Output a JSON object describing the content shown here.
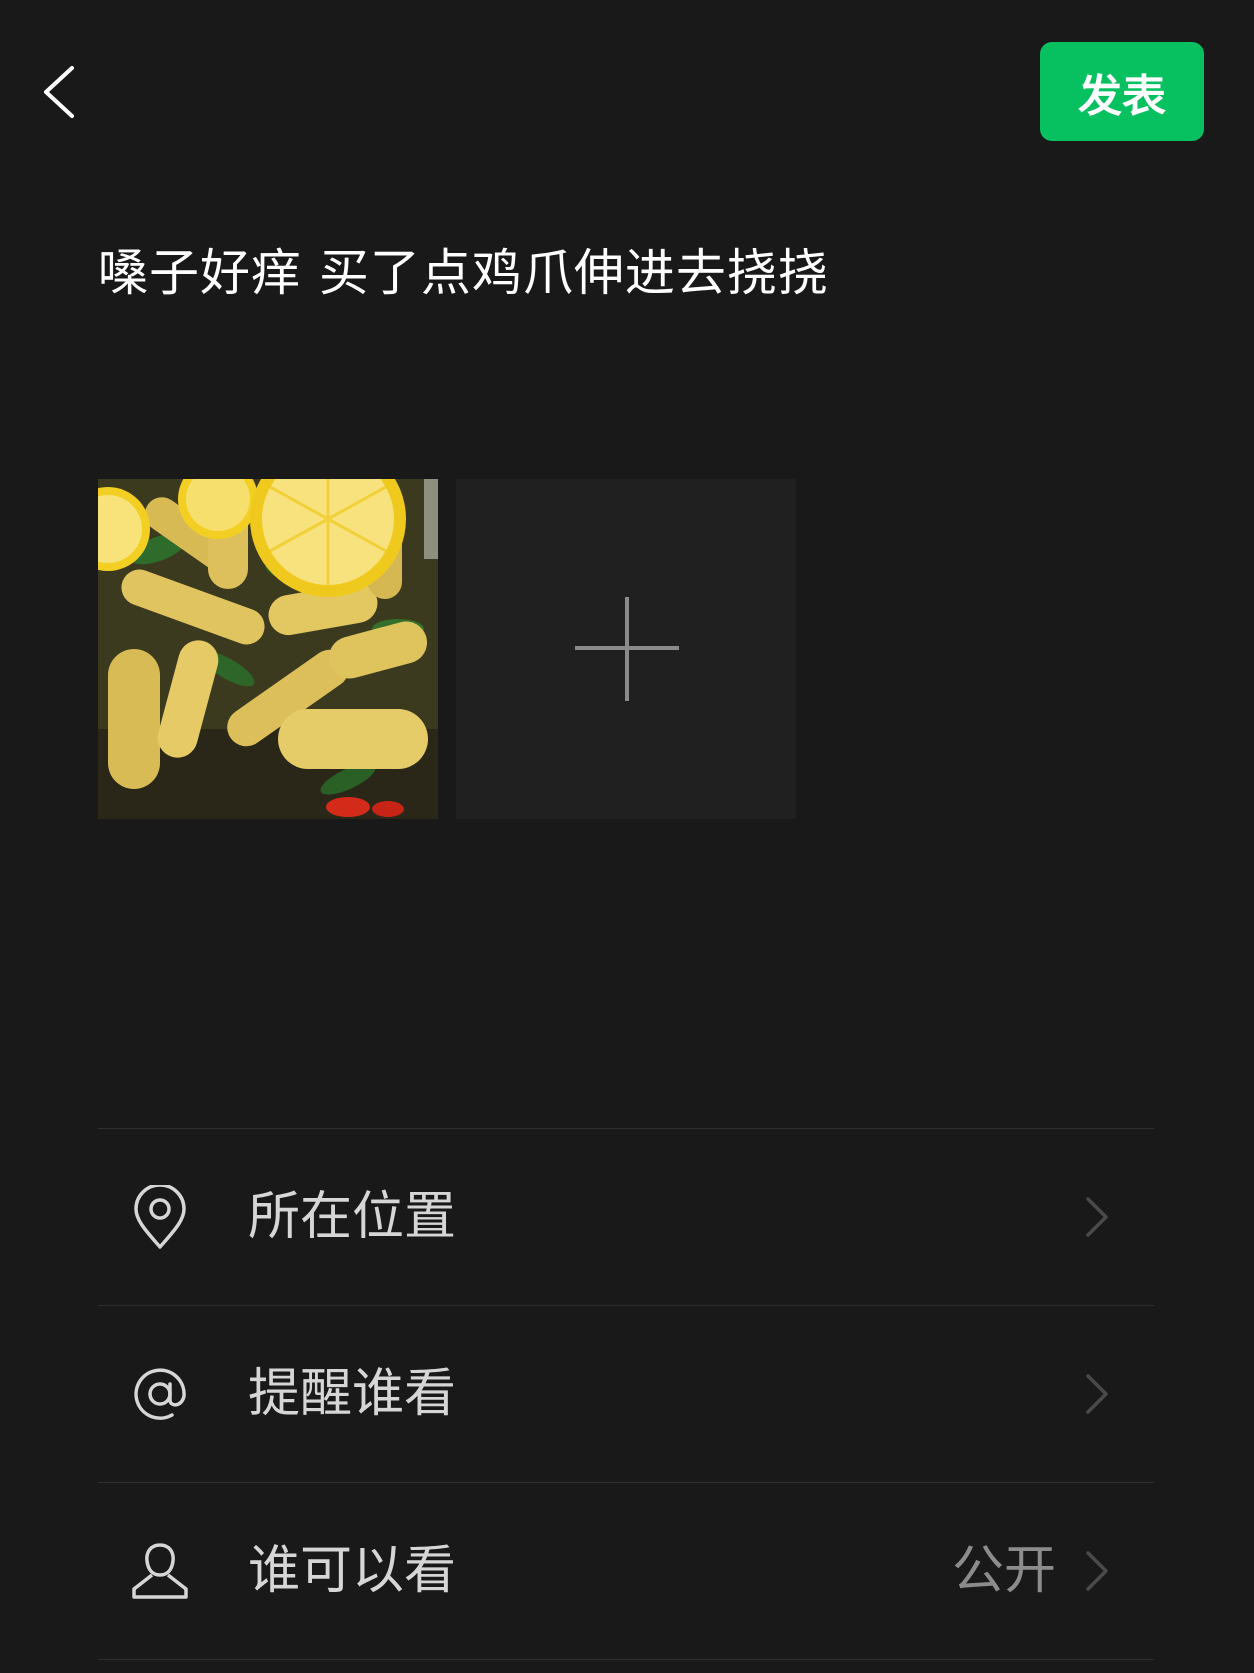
{
  "header": {
    "publish_label": "发表"
  },
  "post": {
    "text": "嗓子好痒 买了点鸡爪伸进去挠挠"
  },
  "media": {
    "photos": [
      {
        "subject": "chicken feet with lemon slices"
      }
    ],
    "add_icon": "plus-icon"
  },
  "options": {
    "location": {
      "label": "所在位置",
      "icon": "location-pin-icon"
    },
    "mention": {
      "label": "提醒谁看",
      "icon": "at-icon"
    },
    "visibility": {
      "label": "谁可以看",
      "value": "公开",
      "icon": "person-icon"
    }
  },
  "colors": {
    "background": "#191919",
    "accent": "#07c160",
    "label": "#d6d6d6",
    "secondary": "#8c8c8c"
  }
}
